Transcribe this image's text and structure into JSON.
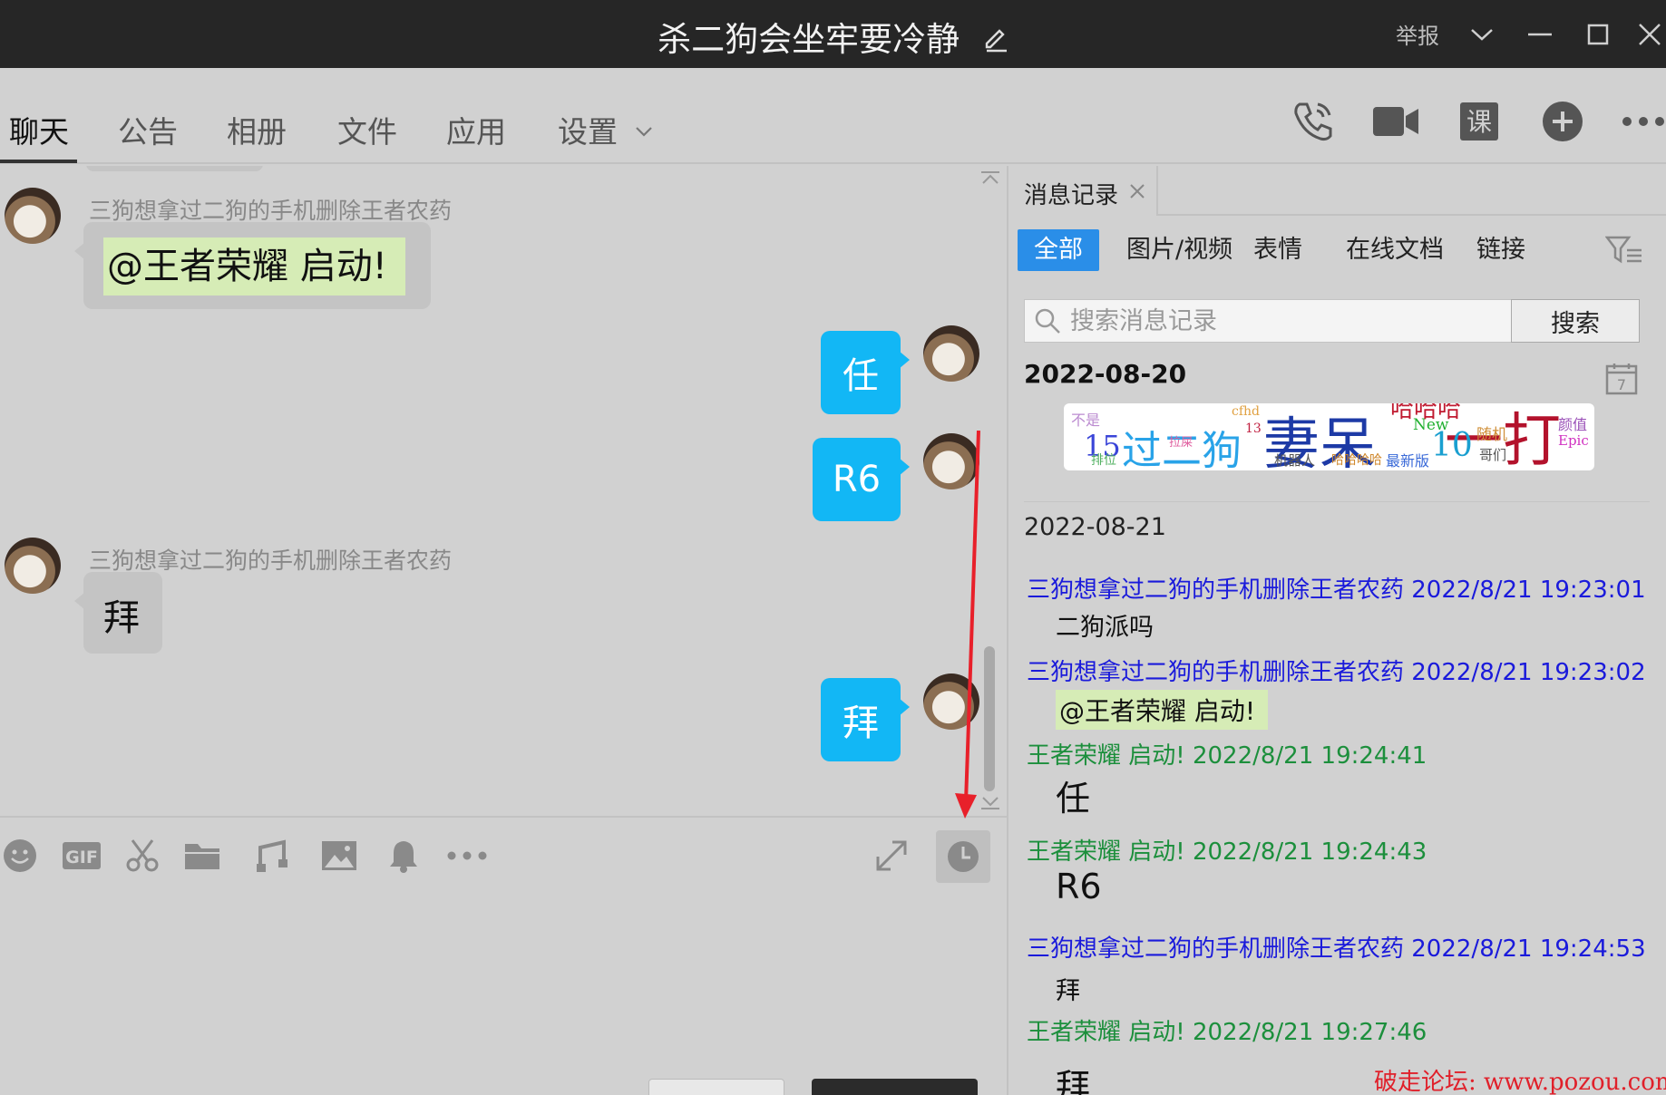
{
  "window": {
    "title": "杀二狗会坐牢要冷静",
    "report_label": "举报"
  },
  "tabs": [
    {
      "label": "聊天",
      "active": true
    },
    {
      "label": "公告"
    },
    {
      "label": "相册"
    },
    {
      "label": "文件"
    },
    {
      "label": "应用"
    },
    {
      "label": "设置"
    }
  ],
  "toolbar_icons": [
    "phone-icon",
    "video-call-icon",
    "class-icon",
    "add-circle-icon",
    "more-icon"
  ],
  "toolbar_class_glyph": "课",
  "chat": {
    "messages": [
      {
        "side": "left",
        "sender": "三狗想拿过二狗的手机删除王者农药",
        "mention": "@王者荣耀 启动!"
      },
      {
        "side": "right",
        "text": "任"
      },
      {
        "side": "right",
        "text": "R6"
      },
      {
        "side": "left",
        "sender": "三狗想拿过二狗的手机删除王者农药",
        "text": "拜"
      },
      {
        "side": "right",
        "text": "拜"
      }
    ]
  },
  "input_toolbar_icons": [
    "emoji-icon",
    "gif-icon",
    "scissors-icon",
    "folder-icon",
    "music-icon",
    "image-icon",
    "bell-icon",
    "more-icon",
    "expand-icon",
    "history-clock-icon"
  ],
  "gif_label": "GIF",
  "history": {
    "tab_label": "消息记录",
    "filters": [
      "全部",
      "图片/视频",
      "表情",
      "在线文档",
      "链接"
    ],
    "search_placeholder": "搜索消息记录",
    "search_button": "搜索",
    "calendar_day": "7",
    "date1": "2022-08-20",
    "wordcloud_words": [
      "15",
      "过二狗",
      "妻呆",
      "一打",
      "10",
      "不是",
      "cfhd",
      "13",
      "New",
      "随机",
      "颜值",
      "Epic",
      "机器人",
      "哈哈哈哈",
      "最新版",
      "哥们",
      "拉屎",
      "排位",
      "哈哈哈"
    ],
    "date2": "2022-08-21",
    "records": [
      {
        "header": "三狗想拿过二狗的手机删除王者农药 2022/8/21 19:23:01",
        "color": "blue",
        "body": "二狗派吗"
      },
      {
        "header": "三狗想拿过二狗的手机删除王者农药 2022/8/21 19:23:02",
        "color": "blue",
        "mention": "@王者荣耀 启动!"
      },
      {
        "header": "王者荣耀 启动!   2022/8/21 19:24:41",
        "color": "green",
        "body": "任"
      },
      {
        "header": "王者荣耀 启动!   2022/8/21 19:24:43",
        "color": "green",
        "body": "R6"
      },
      {
        "header": "三狗想拿过二狗的手机删除王者农药 2022/8/21 19:24:53",
        "color": "blue",
        "body": "拜"
      },
      {
        "header": "王者荣耀 启动!   2022/8/21 19:27:46",
        "color": "green",
        "body": "拜"
      }
    ]
  },
  "watermark": "破走论坛: www.pozou.com",
  "colors": {
    "accent_blue": "#12b7f5",
    "filter_active": "#2a8ee8",
    "sender_blue": "#1a1adb",
    "sender_green": "#1c8f3c",
    "mention_bg": "#d6ecb6",
    "annotation_red": "#e8202a"
  }
}
